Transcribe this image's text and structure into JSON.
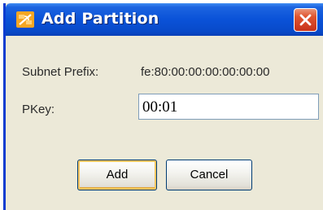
{
  "window": {
    "title": "Add Partition",
    "icon": "partition-app-icon",
    "close_icon": "close-icon"
  },
  "form": {
    "subnet_prefix_label": "Subnet Prefix:",
    "subnet_prefix_value": "fe:80:00:00:00:00:00:00",
    "pkey_label": "PKey:",
    "pkey_value": "00:01"
  },
  "buttons": {
    "add_label": "Add",
    "cancel_label": "Cancel"
  },
  "colors": {
    "titlebar": "#0a52d8",
    "close_button": "#e0552f",
    "dialog_background": "#ece9d8",
    "default_button_focus": "#f9c660"
  }
}
